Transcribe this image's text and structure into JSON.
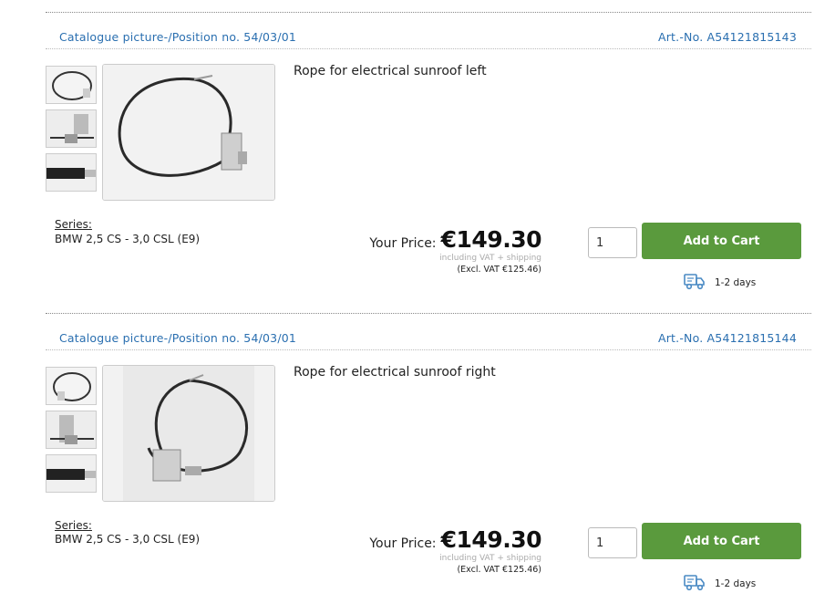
{
  "products": [
    {
      "catalogue_position": "Catalogue picture-/Position no. 54/03/01",
      "article_number": "Art.-No. A54121815143",
      "name": "Rope for electrical sunroof left",
      "series_label": "Series:",
      "series_value": "BMW 2,5 CS - 3,0 CSL (E9)",
      "price_label": "Your Price:",
      "price": "€149.30",
      "vat_note": "including VAT + shipping",
      "excl_vat": "(Excl. VAT €125.46)",
      "quantity": "1",
      "add_to_cart": "Add to Cart",
      "delivery": "1-2 days"
    },
    {
      "catalogue_position": "Catalogue picture-/Position no. 54/03/01",
      "article_number": "Art.-No. A54121815144",
      "name": "Rope for electrical sunroof right",
      "series_label": "Series:",
      "series_value": "BMW 2,5 CS - 3,0 CSL (E9)",
      "price_label": "Your Price:",
      "price": "€149.30",
      "vat_note": "including VAT + shipping",
      "excl_vat": "(Excl. VAT €125.46)",
      "quantity": "1",
      "add_to_cart": "Add to Cart",
      "delivery": "1-2 days"
    }
  ],
  "colors": {
    "link_blue": "#2a6fb0",
    "cart_green": "#5a9a3d",
    "delivery_icon": "#4a8ac4"
  },
  "icons": [
    "delivery-truck-icon"
  ]
}
